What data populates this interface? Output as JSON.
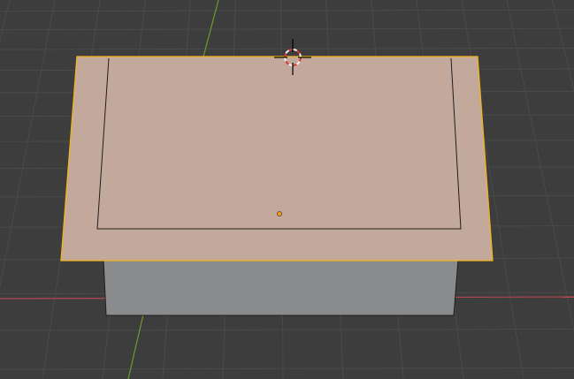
{
  "viewport": {
    "background_color": "#3d3d3d",
    "grid_color": "#4a4a4a",
    "x_axis_color": "#b3474f",
    "y_axis_color": "#6e9a2e"
  },
  "scene": {
    "selected_face_color": "#c2a99c",
    "side_face_color": "#898b8c",
    "selection_outline_color": "#f2b51d",
    "edge_color": "#1e1e1e",
    "origin_point_color": "#f29a1d",
    "cursor": {
      "icon": "3d-cursor-icon",
      "ring_colors": [
        "#d9362e",
        "#f0f0f0"
      ]
    }
  }
}
